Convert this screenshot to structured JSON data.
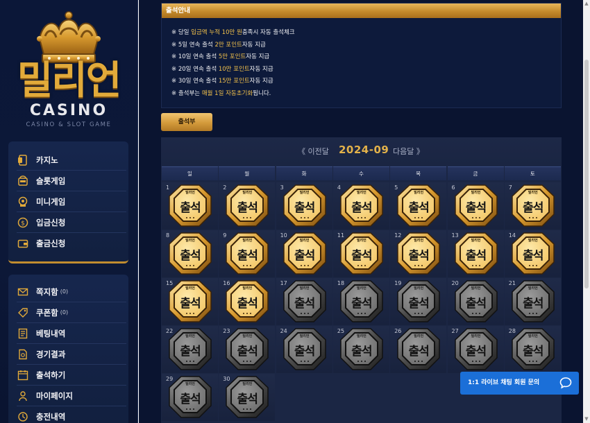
{
  "brand": {
    "logo_text": "밀리언",
    "sub_text": "CASINO",
    "tagline": "CASINO & SLOT GAME",
    "colors": {
      "gold": "#e2aa3a",
      "navy": "#0b1738"
    }
  },
  "sidebar": {
    "primary_menu": [
      {
        "label": "카지노",
        "icon": "casino-chip-icon"
      },
      {
        "label": "슬롯게임",
        "icon": "slot-machine-icon"
      },
      {
        "label": "미니게임",
        "icon": "mini-game-icon"
      },
      {
        "label": "입금신청",
        "icon": "dollar-coin-icon"
      },
      {
        "label": "출금신청",
        "icon": "wallet-icon"
      }
    ],
    "secondary_menu": [
      {
        "label": "쪽지함",
        "count": "(0)",
        "icon": "envelope-icon"
      },
      {
        "label": "쿠폰함",
        "count": "(0)",
        "icon": "coupon-tag-icon"
      },
      {
        "label": "베팅내역",
        "icon": "betting-list-icon"
      },
      {
        "label": "경기결과",
        "icon": "result-document-icon"
      },
      {
        "label": "출석하기",
        "icon": "attendance-calendar-icon"
      },
      {
        "label": "마이페이지",
        "icon": "user-icon"
      },
      {
        "label": "충전내역",
        "icon": "history-icon"
      }
    ]
  },
  "notice": {
    "title": "출석안내",
    "lines": [
      {
        "pre": "※ 당일 ",
        "hl": "입금액 누적 10만 원",
        "post": "충족시 자동 출석체크"
      },
      {
        "pre": "※ 5일 연속 출석 ",
        "hl": "2만 포인트",
        "post": "자동 지급"
      },
      {
        "pre": "※ 10일 연속 출석 ",
        "hl": "5만 포인트",
        "post": "자동 지급"
      },
      {
        "pre": "※ 20일 연속 출석 ",
        "hl": "10만 포인트",
        "post": "자동 지급"
      },
      {
        "pre": "※ 30일 연속 출석 ",
        "hl": "15만 포인트",
        "post": "자동 지급"
      },
      {
        "pre": "※ 출석부는 ",
        "hl": "매월 1일 자동초기화",
        "post": "됩니다."
      }
    ]
  },
  "tab": {
    "label": "출석부"
  },
  "calendar": {
    "prev_label": "《 이전달",
    "current": "2024-09",
    "next_label": "다음달 》",
    "weekdays": [
      "일",
      "월",
      "화",
      "수",
      "목",
      "금",
      "토"
    ],
    "badge_text": "출석",
    "badge_logo_text": "밀리언",
    "days": [
      {
        "day": "1",
        "checked": true
      },
      {
        "day": "2",
        "checked": true
      },
      {
        "day": "3",
        "checked": true
      },
      {
        "day": "4",
        "checked": true
      },
      {
        "day": "5",
        "checked": true
      },
      {
        "day": "6",
        "checked": true
      },
      {
        "day": "7",
        "checked": true
      },
      {
        "day": "8",
        "checked": true
      },
      {
        "day": "9",
        "checked": true
      },
      {
        "day": "10",
        "checked": true
      },
      {
        "day": "11",
        "checked": true
      },
      {
        "day": "12",
        "checked": true
      },
      {
        "day": "13",
        "checked": true
      },
      {
        "day": "14",
        "checked": true
      },
      {
        "day": "15",
        "checked": true
      },
      {
        "day": "16",
        "checked": true
      },
      {
        "day": "17",
        "checked": false
      },
      {
        "day": "18",
        "checked": false
      },
      {
        "day": "19",
        "checked": false
      },
      {
        "day": "20",
        "checked": false
      },
      {
        "day": "21",
        "checked": false
      },
      {
        "day": "22",
        "checked": false
      },
      {
        "day": "23",
        "checked": false
      },
      {
        "day": "24",
        "checked": false
      },
      {
        "day": "25",
        "checked": false
      },
      {
        "day": "26",
        "checked": false
      },
      {
        "day": "27",
        "checked": false
      },
      {
        "day": "28",
        "checked": false
      },
      {
        "day": "29",
        "checked": false
      },
      {
        "day": "30",
        "checked": false
      }
    ]
  },
  "chat": {
    "label": "1:1 라이브 채팅 회원 문의",
    "icon": "chat-bubble-icon",
    "color": "#1b6fd8"
  }
}
